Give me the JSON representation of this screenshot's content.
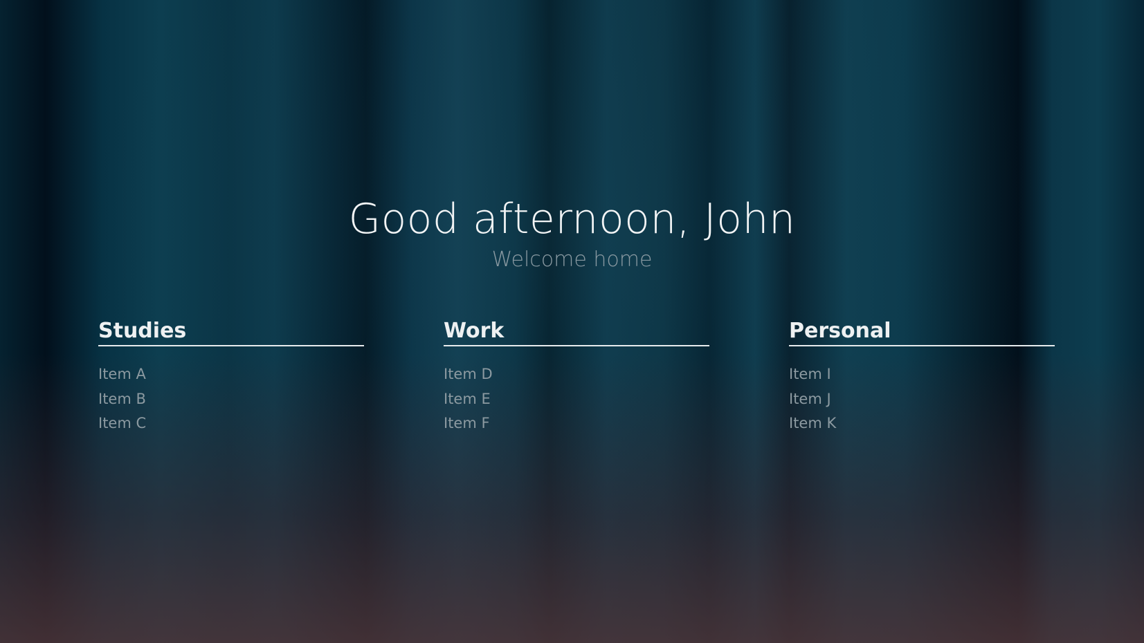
{
  "header": {
    "greeting": "Good afternoon, John",
    "subtitle": "Welcome home"
  },
  "columns": [
    {
      "title": "Studies",
      "items": [
        "Item A",
        "Item B",
        "Item C"
      ]
    },
    {
      "title": "Work",
      "items": [
        "Item D",
        "Item E",
        "Item F"
      ]
    },
    {
      "title": "Personal",
      "items": [
        "Item I",
        "Item J",
        "Item K"
      ]
    }
  ],
  "colors": {
    "heading": "#f2f4f5",
    "subtitle": "#8a9aa2",
    "item_text": "#8c9aa1",
    "divider": "#e8ecee",
    "background": "#0a2a36"
  }
}
